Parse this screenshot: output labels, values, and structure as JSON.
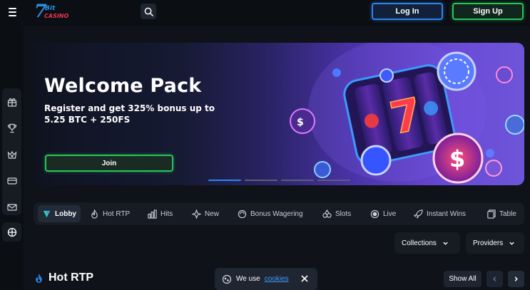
{
  "header": {
    "logo": {
      "seven": "7",
      "bit": "Bit",
      "casino": "CASINO"
    },
    "login_label": "Log In",
    "signup_label": "Sign Up"
  },
  "banner": {
    "title": "Welcome Pack",
    "subtitle": "Register and get 325% bonus up to 5.25 BTC + 250FS",
    "join_label": "Join",
    "slides_total": 4,
    "active_slide": 1
  },
  "categories": [
    {
      "label": "Lobby",
      "icon": "lobby-icon"
    },
    {
      "label": "Hot RTP",
      "icon": "flame-icon"
    },
    {
      "label": "Hits",
      "icon": "hits-icon"
    },
    {
      "label": "New",
      "icon": "sparkle-icon"
    },
    {
      "label": "Bonus Wagering",
      "icon": "bonus-icon"
    },
    {
      "label": "Slots",
      "icon": "slots-icon"
    },
    {
      "label": "Live",
      "icon": "live-icon"
    },
    {
      "label": "Instant Wins",
      "icon": "rocket-icon"
    },
    {
      "label": "Table",
      "icon": "table-icon"
    }
  ],
  "filters": {
    "collections_label": "Collections",
    "providers_label": "Providers"
  },
  "section": {
    "title": "Hot RTP",
    "show_all_label": "Show All"
  },
  "cookie": {
    "text": "We use",
    "link": "cookies"
  },
  "colors": {
    "accent_blue": "#2a86ee",
    "accent_green": "#27c45a",
    "background": "#0f1218"
  }
}
